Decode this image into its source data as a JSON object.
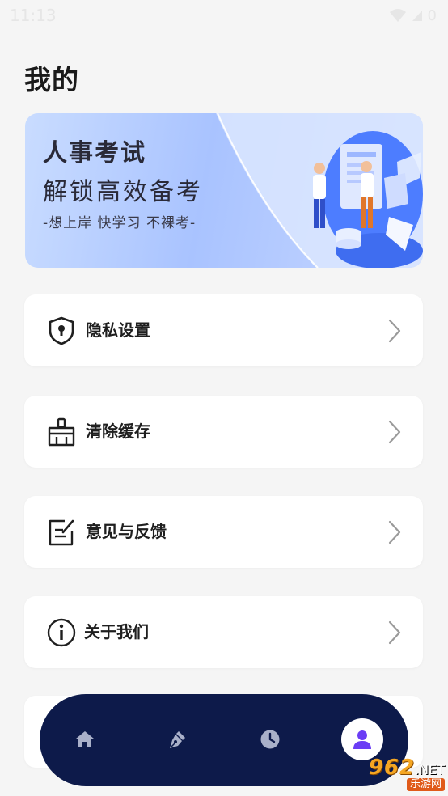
{
  "status_bar": {
    "time": "11:13",
    "battery": "0"
  },
  "page": {
    "title": "我的"
  },
  "banner": {
    "title": "人事考试",
    "subtitle": "解锁高效备考",
    "tagline": "-想上岸 快学习 不裸考-"
  },
  "menu": {
    "items": [
      {
        "label": "隐私设置",
        "icon": "shield-lock-icon"
      },
      {
        "label": "清除缓存",
        "icon": "broom-icon"
      },
      {
        "label": "意见与反馈",
        "icon": "note-edit-icon"
      },
      {
        "label": "关于我们",
        "icon": "info-icon"
      }
    ]
  },
  "nav": {
    "items": [
      {
        "icon": "home-icon",
        "active": false
      },
      {
        "icon": "pen-nib-icon",
        "active": false
      },
      {
        "icon": "clock-icon",
        "active": false
      },
      {
        "icon": "user-icon",
        "active": true
      }
    ],
    "colors": {
      "background": "#0d1a4a",
      "inactive": "#a9b0c9",
      "active": "#6b3df5"
    }
  },
  "watermark": {
    "main": "962",
    "suffix": ".NET",
    "sub": "乐游网"
  }
}
